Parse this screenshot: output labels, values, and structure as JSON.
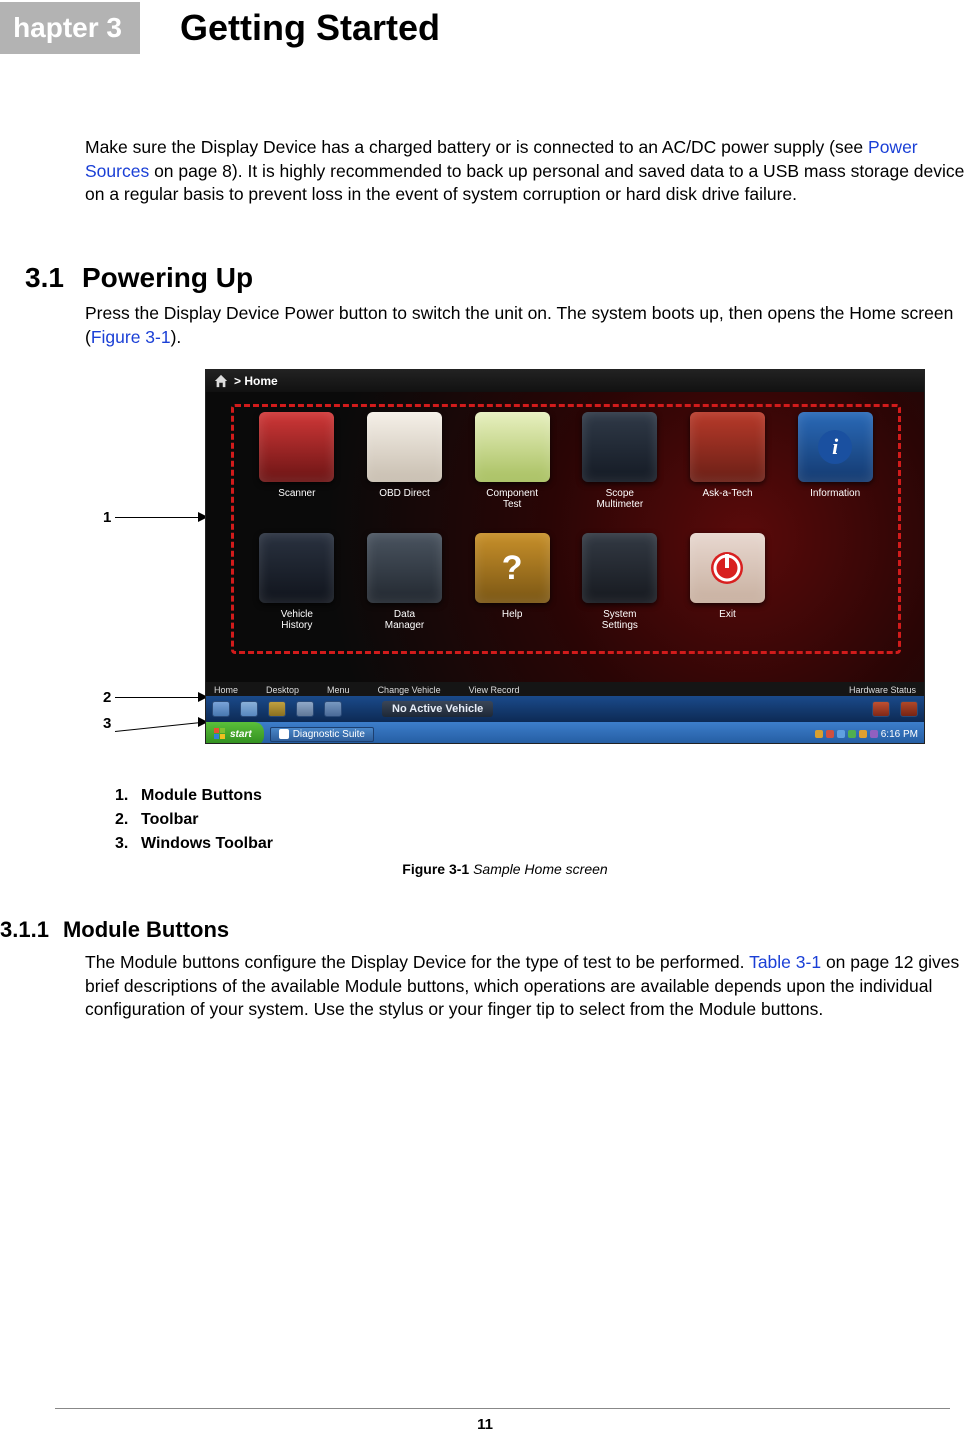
{
  "chapter": {
    "tab": "hapter 3",
    "title": "Getting Started"
  },
  "intro": {
    "before_link": "Make sure the Display Device has a charged battery or is connected to an AC/DC power supply (see ",
    "link": "Power Sources",
    "after_link": " on page 8). It is highly recommended to back up personal and saved data to a USB mass storage device on a regular basis to prevent loss in the event of system corruption or hard disk drive failure."
  },
  "section_3_1": {
    "num": "3.1",
    "title": "Powering Up",
    "body_before": "Press the Display Device Power button to switch the unit on. The system boots up, then opens the Home screen (",
    "body_link": "Figure 3-1",
    "body_after": ")."
  },
  "callouts": {
    "c1": "1",
    "c2": "2",
    "c3": "3"
  },
  "screenshot": {
    "breadcrumb": "> Home",
    "modules_row1": [
      {
        "label": "Scanner",
        "bg": "linear-gradient(#d03838,#6b1414)",
        "name": "module-scanner"
      },
      {
        "label": "OBD Direct",
        "bg": "linear-gradient(#f5f0e8,#c8beb0)",
        "name": "module-obd-direct"
      },
      {
        "label": "Component\nTest",
        "bg": "linear-gradient(#e8f0c0,#a8c060)",
        "name": "module-component-test"
      },
      {
        "label": "Scope\nMultimeter",
        "bg": "linear-gradient(#303a48,#141a24)",
        "name": "module-scope-multimeter"
      },
      {
        "label": "Ask-a-Tech",
        "bg": "linear-gradient(#b83a2a,#6a1f16)",
        "name": "module-ask-a-tech"
      },
      {
        "label": "Information",
        "bg": "linear-gradient(#2a6ab8,#143a70)",
        "name": "module-information"
      }
    ],
    "modules_row2": [
      {
        "label": "Vehicle\nHistory",
        "bg": "linear-gradient(#2a3240,#10141c)",
        "name": "module-vehicle-history"
      },
      {
        "label": "Data\nManager",
        "bg": "linear-gradient(#4a5460,#222830)",
        "name": "module-data-manager"
      },
      {
        "label": "Help",
        "bg": "linear-gradient(#c8902a,#7a5614)",
        "name": "module-help"
      },
      {
        "label": "System\nSettings",
        "bg": "linear-gradient(#333a44,#16191f)",
        "name": "module-system-settings"
      },
      {
        "label": "Exit",
        "bg": "linear-gradient(#e8d8d0,#c8b0a0)",
        "name": "module-exit"
      }
    ],
    "toolbar": [
      "Home",
      "Desktop",
      "Menu",
      "Change Vehicle",
      "View Record"
    ],
    "toolbar_right": "Hardware Status",
    "statusbar_text": "No Active Vehicle",
    "start": "start",
    "task": "Diagnostic Suite",
    "time": "6:16 PM"
  },
  "legend": {
    "l1": "Module Buttons",
    "l2": "Toolbar",
    "l3": "Windows Toolbar"
  },
  "figure_caption": {
    "bold": "Figure 3-1",
    "italic": " Sample Home screen"
  },
  "section_3_1_1": {
    "num": "3.1.1",
    "title": "Module Buttons",
    "body_before": "The Module buttons configure the Display Device for the type of test to be performed. ",
    "body_link": "Table 3-1",
    "body_after": " on page 12 gives brief descriptions of the available Module buttons, which operations are available depends upon the individual configuration of your system. Use the stylus or your finger tip to select from the Module buttons."
  },
  "page_number": "11"
}
